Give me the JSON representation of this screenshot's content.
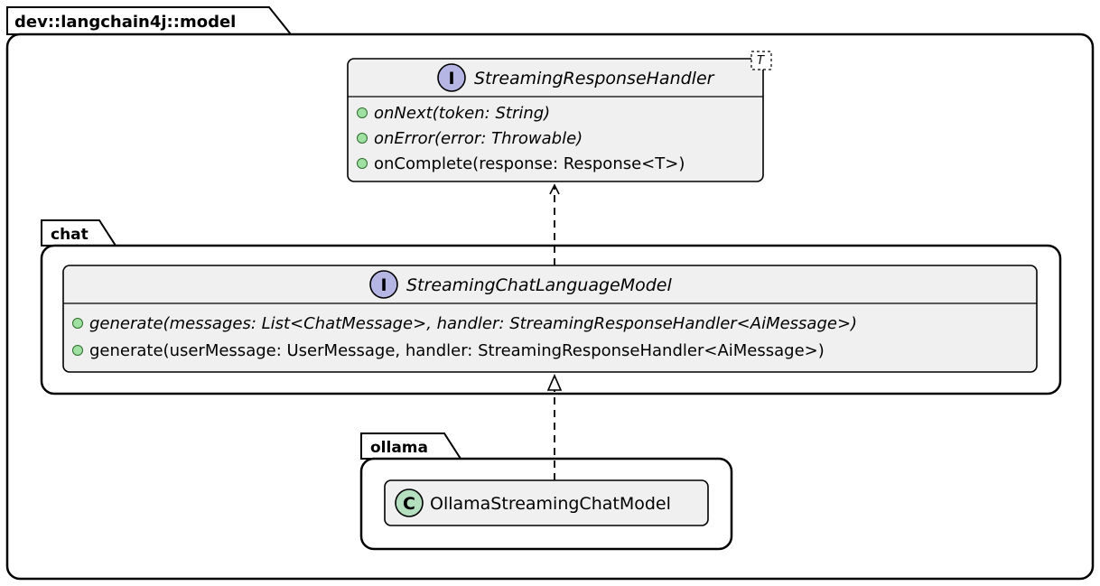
{
  "package": {
    "name": "dev::langchain4j::model",
    "sub_packages": {
      "chat": {
        "name": "chat"
      },
      "ollama": {
        "name": "ollama"
      }
    }
  },
  "interfaces": {
    "streaming_response_handler": {
      "name": "StreamingResponseHandler",
      "stereotype": "I",
      "template": "T",
      "members": [
        {
          "sig": "onNext(token: String)",
          "abstract": true
        },
        {
          "sig": "onError(error: Throwable)",
          "abstract": true
        },
        {
          "sig": "onComplete(response: Response<T>)",
          "abstract": false
        }
      ]
    },
    "streaming_chat_language_model": {
      "name": "StreamingChatLanguageModel",
      "stereotype": "I",
      "members": [
        {
          "sig": "generate(messages: List<ChatMessage>, handler: StreamingResponseHandler<AiMessage>)",
          "abstract": true
        },
        {
          "sig": "generate(userMessage: UserMessage, handler: StreamingResponseHandler<AiMessage>)",
          "abstract": false
        }
      ]
    }
  },
  "classes": {
    "ollama_streaming_chat_model": {
      "name": "OllamaStreamingChatModel",
      "stereotype": "C"
    }
  },
  "relations": [
    {
      "from": "streaming_chat_language_model",
      "to": "streaming_response_handler",
      "type": "dependency"
    },
    {
      "from": "ollama_streaming_chat_model",
      "to": "streaming_chat_language_model",
      "type": "realization"
    }
  ],
  "chart_data": {
    "type": "uml-class-diagram",
    "packages": [
      {
        "name": "dev::langchain4j::model",
        "children": [
          {
            "kind": "interface",
            "name": "StreamingResponseHandler",
            "template_params": [
              "T"
            ],
            "methods": [
              {
                "name": "onNext",
                "params": [
                  {
                    "name": "token",
                    "type": "String"
                  }
                ],
                "abstract": true,
                "visibility": "public"
              },
              {
                "name": "onError",
                "params": [
                  {
                    "name": "error",
                    "type": "Throwable"
                  }
                ],
                "abstract": true,
                "visibility": "public"
              },
              {
                "name": "onComplete",
                "params": [
                  {
                    "name": "response",
                    "type": "Response<T>"
                  }
                ],
                "abstract": false,
                "visibility": "public"
              }
            ]
          },
          {
            "kind": "package",
            "name": "chat",
            "children": [
              {
                "kind": "interface",
                "name": "StreamingChatLanguageModel",
                "methods": [
                  {
                    "name": "generate",
                    "params": [
                      {
                        "name": "messages",
                        "type": "List<ChatMessage>"
                      },
                      {
                        "name": "handler",
                        "type": "StreamingResponseHandler<AiMessage>"
                      }
                    ],
                    "abstract": true,
                    "visibility": "public"
                  },
                  {
                    "name": "generate",
                    "params": [
                      {
                        "name": "userMessage",
                        "type": "UserMessage"
                      },
                      {
                        "name": "handler",
                        "type": "StreamingResponseHandler<AiMessage>"
                      }
                    ],
                    "abstract": false,
                    "visibility": "public"
                  }
                ]
              }
            ]
          },
          {
            "kind": "package",
            "name": "ollama",
            "children": [
              {
                "kind": "class",
                "name": "OllamaStreamingChatModel"
              }
            ]
          }
        ]
      }
    ],
    "edges": [
      {
        "from": "StreamingChatLanguageModel",
        "to": "StreamingResponseHandler",
        "type": "dependency"
      },
      {
        "from": "OllamaStreamingChatModel",
        "to": "StreamingChatLanguageModel",
        "type": "realization"
      }
    ]
  }
}
